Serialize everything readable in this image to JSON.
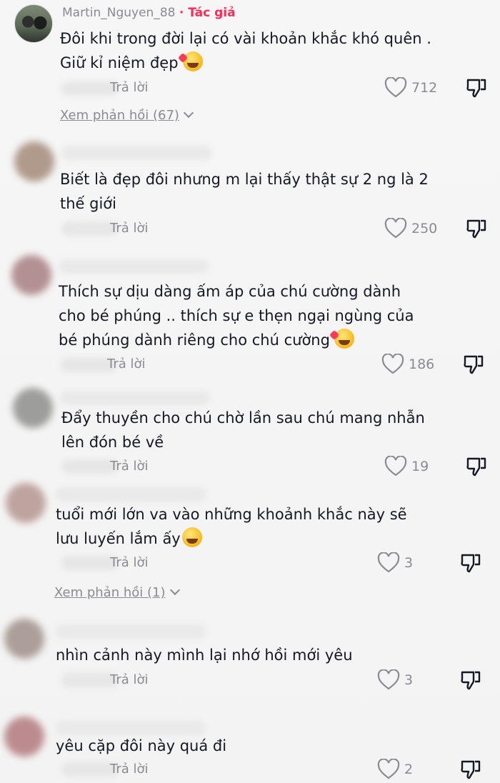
{
  "reply_label": "Trả lời",
  "comments": [
    {
      "username": "Martin_Nguyen_88",
      "author_tag": "· Tác giả",
      "line1": "Đôi khi trong đời lại có vài khoản khắc khó quên .",
      "line2": "Giữ kỉ niệm đẹp",
      "emoji": "smiling-face-with-hearts",
      "likes": "712",
      "view_replies": "Xem phản hồi (67)"
    },
    {
      "line1": "Biết là đẹp đôi nhưng m lại thấy thật sự 2 ng là 2",
      "line2": "thế giới",
      "likes": "250"
    },
    {
      "line1": "Thích sự dịu dàng ấm áp của chú cường dành",
      "line2": "cho bé phúng .. thích sự e thẹn ngại ngùng của",
      "line3": "bé phúng dành riêng cho chú cường",
      "emoji": "smiling-face-with-hearts",
      "likes": "186"
    },
    {
      "line1": "Đẩy thuyền cho chú chờ lần sau chú mang nhẫn",
      "line2": "lên đón bé về",
      "likes": "19"
    },
    {
      "line1": "tuổi mới lớn va vào những khoảnh khắc này sẽ",
      "line2": "lưu luyến lắm ấy",
      "emoji": "grinning-face",
      "likes": "3",
      "view_replies": "Xem phản hồi (1)"
    },
    {
      "line1": "nhìn cảnh này mình lại nhớ hồi mới yêu",
      "likes": "3"
    },
    {
      "line1": "yêu cặp đôi này quá đi",
      "likes": "2"
    }
  ],
  "colors": {
    "text": "#161823",
    "secondary": "#8a8b91",
    "author_accent": "#fe2c55"
  }
}
